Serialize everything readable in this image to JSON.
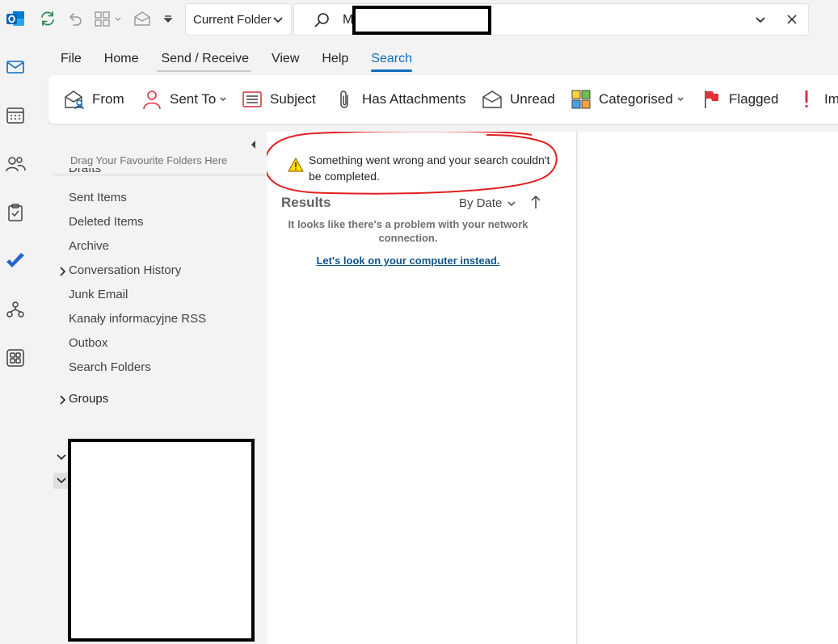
{
  "search": {
    "scope": "Current Folder",
    "query_visible": "M"
  },
  "menu": {
    "tabs": [
      {
        "label": "File"
      },
      {
        "label": "Home"
      },
      {
        "label": "Send / Receive"
      },
      {
        "label": "View"
      },
      {
        "label": "Help"
      },
      {
        "label": "Search"
      }
    ],
    "active_tab": "Search"
  },
  "ribbon": {
    "from": "From",
    "sent_to": "Sent To",
    "subject": "Subject",
    "has_attachments": "Has Attachments",
    "unread": "Unread",
    "categorised": "Categorised",
    "flagged": "Flagged",
    "importance_partial": "Im"
  },
  "folders": {
    "favourites_hint": "Drag Your Favourite Folders Here",
    "partially_hidden_item": "Drafts",
    "items": [
      {
        "label": "Sent Items"
      },
      {
        "label": "Deleted Items"
      },
      {
        "label": "Archive"
      },
      {
        "label": "Conversation History"
      },
      {
        "label": "Junk Email"
      },
      {
        "label": "Kanały informacyjne RSS"
      },
      {
        "label": "Outbox"
      },
      {
        "label": "Search Folders"
      }
    ],
    "groups": "Groups"
  },
  "results": {
    "error_message": "Something went wrong and your search couldn't be completed.",
    "title": "Results",
    "sort_label": "By Date",
    "network_message": "It looks like there's a problem with your network connection.",
    "local_link": "Let's look on your computer instead."
  },
  "colors": {
    "accent": "#0f6cbd",
    "annotation_red": "#e02020",
    "link": "#0f548c",
    "warning": "#eaa300"
  },
  "icons": {
    "quick_access": [
      "outlook-logo-icon",
      "sync-icon",
      "undo-icon",
      "view-grid-icon",
      "envelope-open-icon",
      "customize-toolbar-icon"
    ],
    "app_bar": [
      "mail-icon",
      "calendar-icon",
      "people-icon",
      "tasks-icon",
      "todo-icon",
      "org-chart-icon",
      "more-apps-icon"
    ]
  }
}
